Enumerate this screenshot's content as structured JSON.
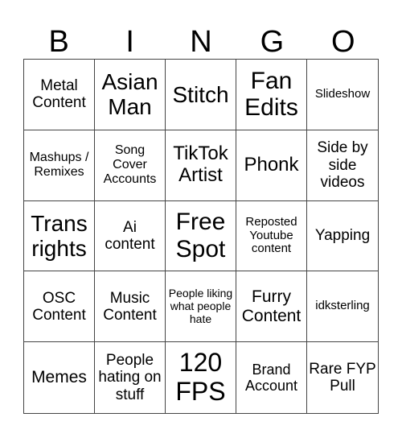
{
  "header": {
    "letters": [
      "B",
      "I",
      "N",
      "G",
      "O"
    ]
  },
  "cells": [
    "Metal Content",
    "Asian Man",
    "Stitch",
    "Fan Edits",
    "Slideshow",
    "Mashups / Remixes",
    "Song Cover Accounts",
    "TikTok Artist",
    "Phonk",
    "Side by side videos",
    "Trans rights",
    "Ai content",
    "Free Spot",
    "Reposted Youtube content",
    "Yapping",
    "OSC Content",
    "Music Content",
    "People liking what people hate",
    "Furry Content",
    "idksterling",
    "Memes",
    "People hating on stuff",
    "120 FPS",
    "Brand Account",
    "Rare FYP Pull"
  ]
}
